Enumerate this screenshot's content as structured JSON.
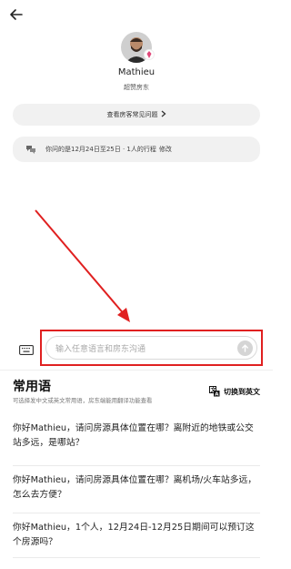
{
  "host": {
    "name": "Mathieu",
    "badge": "超赞房东"
  },
  "faq_button": {
    "label": "查看房客常见问题"
  },
  "inquiry": {
    "text": "你问的是12月24日至25日 · 1人的行程",
    "edit_label": "修改"
  },
  "message_input": {
    "placeholder": "输入任意语言和房东沟通"
  },
  "common_phrases": {
    "title": "常用语",
    "subtitle": "可选择发中文或英文常用语，房东端能用翻译功能查看",
    "switch_label": "切换到英文",
    "items": [
      {
        "text": "你好Mathieu，请问房源具体位置在哪？离附近的地铁或公交站多远，是哪站？"
      },
      {
        "text": "你好Mathieu，请问房源具体位置在哪？离机场/火车站多远，怎么去方便？"
      },
      {
        "text": "你好Mathieu，1个人，12月24日-12月25日期间可以预订这个房源吗？"
      }
    ]
  },
  "colors": {
    "highlight_red": "#e02020",
    "pill_bg": "#f1f1f1"
  }
}
